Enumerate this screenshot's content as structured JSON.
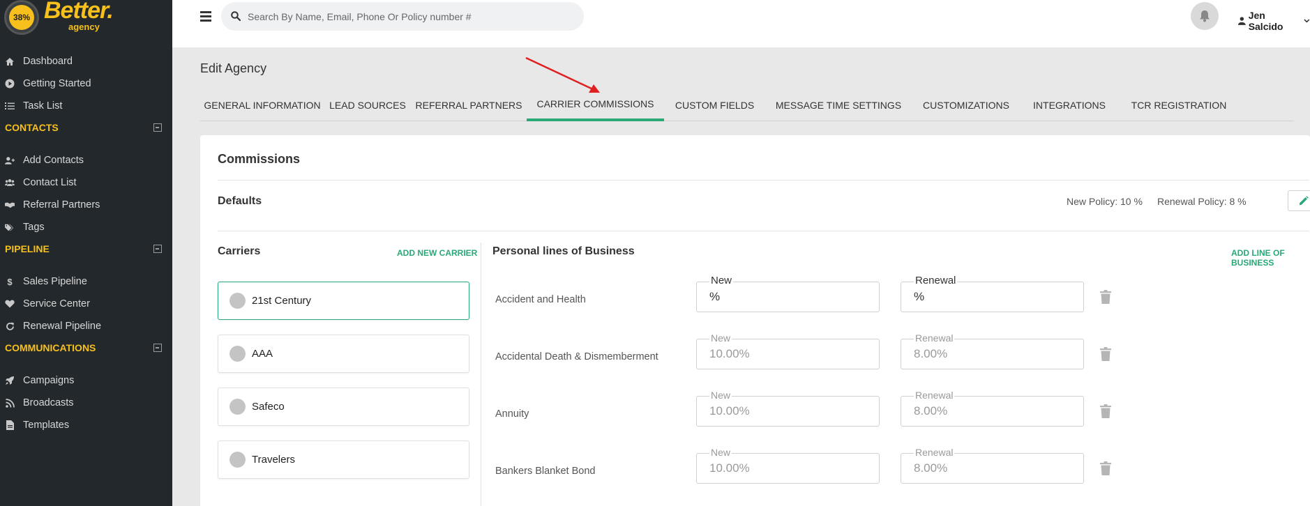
{
  "brand": {
    "badge": "38%",
    "name": "Better.",
    "sub": "agency"
  },
  "sidebar": {
    "top_items": [
      {
        "label": "Dashboard",
        "icon": "home-icon"
      },
      {
        "label": "Getting Started",
        "icon": "play-circle-icon"
      },
      {
        "label": "Task List",
        "icon": "list-icon"
      }
    ],
    "sections": [
      {
        "title": "CONTACTS",
        "items": [
          {
            "label": "Add Contacts",
            "icon": "user-plus-icon"
          },
          {
            "label": "Contact List",
            "icon": "users-icon"
          },
          {
            "label": "Referral Partners",
            "icon": "handshake-icon"
          },
          {
            "label": "Tags",
            "icon": "tags-icon"
          }
        ]
      },
      {
        "title": "PIPELINE",
        "items": [
          {
            "label": "Sales Pipeline",
            "icon": "dollar-icon"
          },
          {
            "label": "Service Center",
            "icon": "heart-icon"
          },
          {
            "label": "Renewal Pipeline",
            "icon": "refresh-icon"
          }
        ]
      },
      {
        "title": "COMMUNICATIONS",
        "items": [
          {
            "label": "Campaigns",
            "icon": "rocket-icon"
          },
          {
            "label": "Broadcasts",
            "icon": "rss-icon"
          },
          {
            "label": "Templates",
            "icon": "file-icon"
          }
        ]
      }
    ]
  },
  "topbar": {
    "search_placeholder": "Search By Name, Email, Phone Or Policy number #",
    "user_name": "Jen Salcido"
  },
  "page": {
    "title": "Edit Agency",
    "tabs": [
      "GENERAL INFORMATION",
      "LEAD SOURCES",
      "REFERRAL PARTNERS",
      "CARRIER COMMISSIONS",
      "CUSTOM FIELDS",
      "MESSAGE TIME SETTINGS",
      "CUSTOMIZATIONS",
      "INTEGRATIONS",
      "TCR REGISTRATION"
    ],
    "active_tab": "CARRIER COMMISSIONS"
  },
  "commissions": {
    "title": "Commissions",
    "defaults_label": "Defaults",
    "new_policy": "New Policy: 10 %",
    "renewal_policy": "Renewal Policy: 8 %",
    "carriers_title": "Carriers",
    "add_carrier": "ADD NEW CARRIER",
    "carriers": [
      "21st Century",
      "AAA",
      "Safeco",
      "Travelers"
    ],
    "selected_carrier": "21st Century",
    "lob_title": "Personal lines of Business",
    "add_lob": "ADD LINE OF BUSINESS",
    "lines": [
      {
        "name": "Accident and Health",
        "new_label": "New",
        "new_value": "%",
        "renewal_label": "Renewal",
        "renewal_value": "%",
        "new_placeholder": "",
        "renewal_placeholder": ""
      },
      {
        "name": "Accidental Death & Dismemberment",
        "new_label": "New",
        "new_value": "",
        "new_placeholder": "10.00%",
        "renewal_label": "Renewal",
        "renewal_value": "",
        "renewal_placeholder": "8.00%"
      },
      {
        "name": "Annuity",
        "new_label": "New",
        "new_value": "",
        "new_placeholder": "10.00%",
        "renewal_label": "Renewal",
        "renewal_value": "",
        "renewal_placeholder": "8.00%"
      },
      {
        "name": "Bankers Blanket Bond",
        "new_label": "New",
        "new_value": "",
        "new_placeholder": "10.00%",
        "renewal_label": "Renewal",
        "renewal_value": "",
        "renewal_placeholder": "8.00%"
      }
    ]
  },
  "colors": {
    "accent": "#2aa876",
    "brand_yellow": "#f7c01c",
    "sidebar_bg": "#22282b",
    "arrow": "#e02020"
  }
}
